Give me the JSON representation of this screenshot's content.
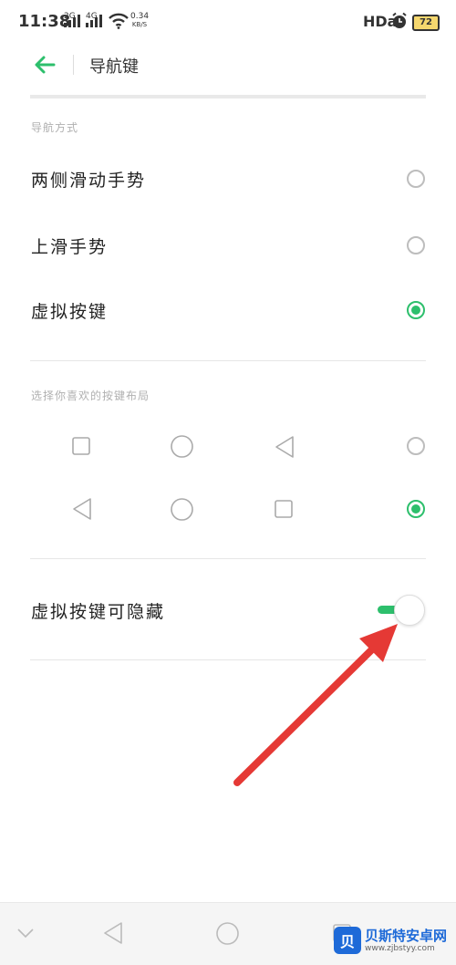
{
  "status_bar": {
    "time": "11:38",
    "net1": "2G",
    "net2": "4G",
    "speed_value": "0.34",
    "speed_unit": "KB/S",
    "hd": "HDa",
    "battery": "72"
  },
  "header": {
    "title": "导航键"
  },
  "nav_mode": {
    "section_title": "导航方式",
    "options": [
      {
        "label": "两侧滑动手势",
        "selected": false
      },
      {
        "label": "上滑手势",
        "selected": false
      },
      {
        "label": "虚拟按键",
        "selected": true
      }
    ]
  },
  "layout": {
    "section_title": "选择你喜欢的按键布局",
    "rows": [
      {
        "icons": [
          "square-icon",
          "circle-icon",
          "triangle-left-icon"
        ],
        "selected": false
      },
      {
        "icons": [
          "triangle-left-icon",
          "circle-icon",
          "square-icon"
        ],
        "selected": true
      }
    ]
  },
  "hide_keys": {
    "label": "虚拟按键可隐藏",
    "enabled": true
  },
  "watermark": {
    "name": "贝斯特安卓网",
    "url": "www.zjbstyy.com",
    "logo_char": "贝"
  },
  "colors": {
    "accent": "#2dbf6c",
    "arrow": "#e53935"
  }
}
